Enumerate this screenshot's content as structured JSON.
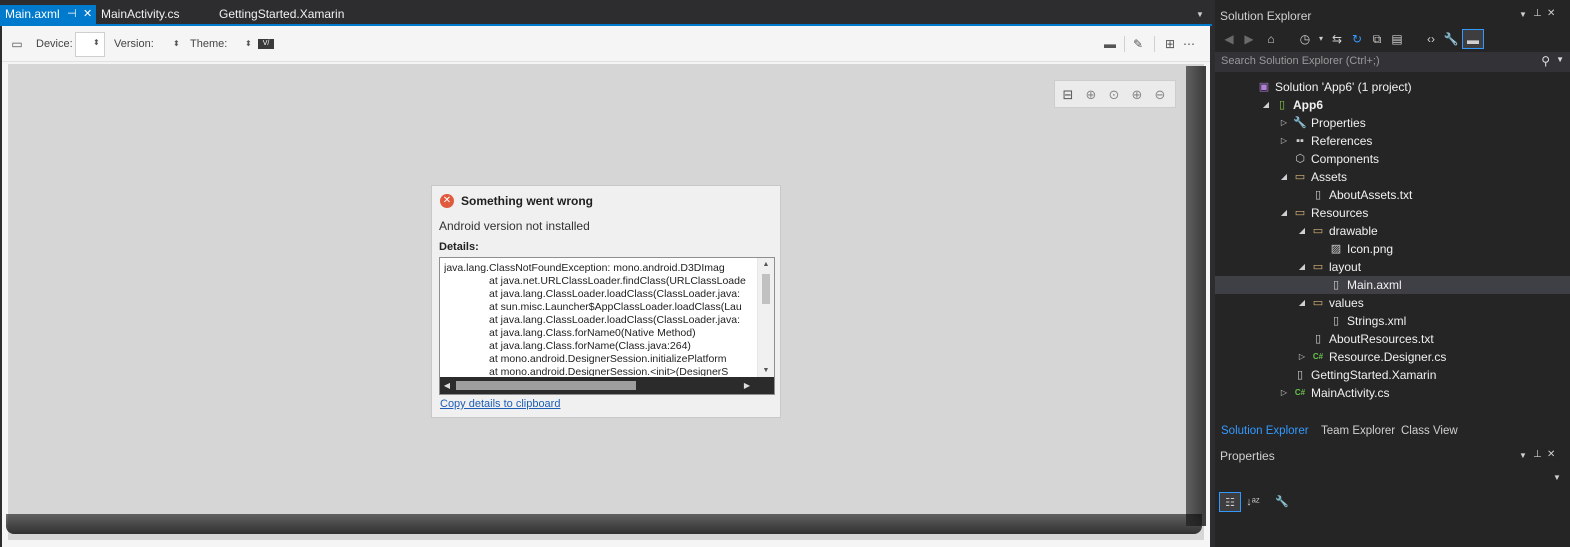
{
  "editor": {
    "tabs": [
      {
        "label": "Main.axml",
        "active": true
      },
      {
        "label": "MainActivity.cs",
        "active": false
      },
      {
        "label": "GettingStarted.Xamarin",
        "active": false
      }
    ],
    "pin_glyph": "⊣",
    "close_glyph": "✕",
    "dropdown_glyph": "▼"
  },
  "designer_toolbar": {
    "device_label": "Device:",
    "version_label": "Version:",
    "theme_label": "Theme:",
    "theme_badge": "V/"
  },
  "error_dialog": {
    "title": "Something went wrong",
    "message": "Android version not installed",
    "details_label": "Details:",
    "details_lines": [
      "java.lang.ClassNotFoundException: mono.android.D3DImag",
      "at java.net.URLClassLoader.findClass(URLClassLoade",
      "at java.lang.ClassLoader.loadClass(ClassLoader.java:",
      "at sun.misc.Launcher$AppClassLoader.loadClass(Lau",
      "at java.lang.ClassLoader.loadClass(ClassLoader.java:",
      "at java.lang.Class.forName0(Native Method)",
      "at java.lang.Class.forName(Class.java:264)",
      "at mono.android.DesignerSession.initializePlatform",
      "at mono.android.DesignerSession.<init>(DesignerS"
    ],
    "copy_link": "Copy details to clipboard"
  },
  "solution_explorer": {
    "title": "Solution Explorer",
    "search_placeholder": "Search Solution Explorer (Ctrl+;)",
    "tree": [
      {
        "label": "Solution 'App6' (1 project)",
        "level": 0,
        "expander": "",
        "icon": "solution-icon",
        "glyph": "▣",
        "color": "#b180d7",
        "bold": false
      },
      {
        "label": "App6",
        "level": 1,
        "expander": "◢",
        "icon": "android-project-icon",
        "glyph": "▯",
        "color": "#8bc34a",
        "bold": true
      },
      {
        "label": "Properties",
        "level": 2,
        "expander": "▷",
        "icon": "wrench-icon",
        "glyph": "🔧",
        "color": "#cfcfcf",
        "bold": false
      },
      {
        "label": "References",
        "level": 2,
        "expander": "▷",
        "icon": "references-icon",
        "glyph": "▪▪",
        "color": "#cfcfcf",
        "bold": false
      },
      {
        "label": "Components",
        "level": 2,
        "expander": "",
        "icon": "components-icon",
        "glyph": "⬡",
        "color": "#cfcfcf",
        "bold": false
      },
      {
        "label": "Assets",
        "level": 2,
        "expander": "◢",
        "icon": "folder-icon",
        "glyph": "▭",
        "color": "#dcb67a",
        "bold": false
      },
      {
        "label": "AboutAssets.txt",
        "level": 3,
        "expander": "",
        "icon": "file-icon",
        "glyph": "▯",
        "color": "#cfcfcf",
        "bold": false
      },
      {
        "label": "Resources",
        "level": 2,
        "expander": "◢",
        "icon": "folder-icon",
        "glyph": "▭",
        "color": "#dcb67a",
        "bold": false
      },
      {
        "label": "drawable",
        "level": 3,
        "expander": "◢",
        "icon": "folder-icon",
        "glyph": "▭",
        "color": "#dcb67a",
        "bold": false
      },
      {
        "label": "Icon.png",
        "level": 4,
        "expander": "",
        "icon": "image-file-icon",
        "glyph": "▨",
        "color": "#cfcfcf",
        "bold": false
      },
      {
        "label": "layout",
        "level": 3,
        "expander": "◢",
        "icon": "folder-icon",
        "glyph": "▭",
        "color": "#dcb67a",
        "bold": false
      },
      {
        "label": "Main.axml",
        "level": 4,
        "expander": "",
        "icon": "file-icon",
        "glyph": "▯",
        "color": "#cfcfcf",
        "bold": false,
        "selected": true
      },
      {
        "label": "values",
        "level": 3,
        "expander": "◢",
        "icon": "folder-icon",
        "glyph": "▭",
        "color": "#dcb67a",
        "bold": false
      },
      {
        "label": "Strings.xml",
        "level": 4,
        "expander": "",
        "icon": "xml-file-icon",
        "glyph": "▯",
        "color": "#cfcfcf",
        "bold": false
      },
      {
        "label": "AboutResources.txt",
        "level": 3,
        "expander": "",
        "icon": "file-icon",
        "glyph": "▯",
        "color": "#cfcfcf",
        "bold": false
      },
      {
        "label": "Resource.Designer.cs",
        "level": 3,
        "expander": "▷",
        "icon": "csharp-file-icon",
        "glyph": "C#",
        "color": "#68c24a",
        "bold": false
      },
      {
        "label": "GettingStarted.Xamarin",
        "level": 2,
        "expander": "",
        "icon": "file-icon",
        "glyph": "▯",
        "color": "#cfcfcf",
        "bold": false
      },
      {
        "label": "MainActivity.cs",
        "level": 2,
        "expander": "▷",
        "icon": "csharp-file-icon",
        "glyph": "C#",
        "color": "#68c24a",
        "bold": false
      }
    ],
    "bottom_tabs": [
      {
        "label": "Solution Explorer",
        "active": true
      },
      {
        "label": "Team Explorer",
        "active": false
      },
      {
        "label": "Class View",
        "active": false
      }
    ]
  },
  "properties_panel": {
    "title": "Properties"
  }
}
